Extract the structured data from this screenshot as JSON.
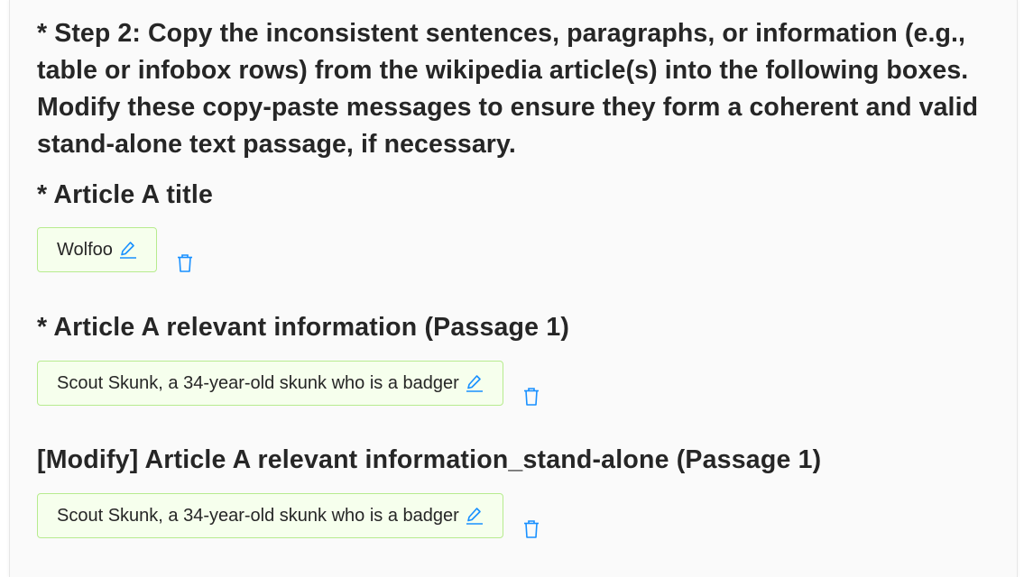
{
  "step": {
    "heading": "* Step 2: Copy the inconsistent sentences, paragraphs, or information (e.g., table or infobox rows) from the wikipedia article(s) into the following boxes. Modify these copy-paste messages to ensure they form a coherent and valid stand-alone text passage, if necessary."
  },
  "sections": {
    "article_a_title": {
      "heading": "* Article A title",
      "value": "Wolfoo"
    },
    "article_a_info": {
      "heading": "* Article A relevant information (Passage 1)",
      "value": "Scout Skunk, a 34-year-old skunk who is a badger"
    },
    "article_a_modify": {
      "heading": "[Modify] Article A relevant information_stand-alone (Passage 1)",
      "value": "Scout Skunk, a 34-year-old skunk who is a badger"
    }
  },
  "icons": {
    "edit": "edit-icon",
    "delete": "delete-icon"
  },
  "colors": {
    "accent": "#1890ff",
    "tag_background": "#f6ffed",
    "tag_border": "#b7eb8f",
    "text": "#262626"
  }
}
